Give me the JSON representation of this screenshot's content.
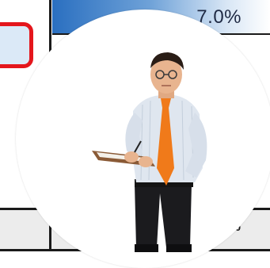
{
  "background": {
    "bar_percentage": "7.0%",
    "bottom_row_percentage": "%",
    "bar_color": "#2a6fc0",
    "highlight_color": "#e4161c"
  },
  "photo": {
    "subject": "man-with-clipboard",
    "tie_color": "#f07a1a",
    "shirt_color": "#dfe6ef"
  }
}
